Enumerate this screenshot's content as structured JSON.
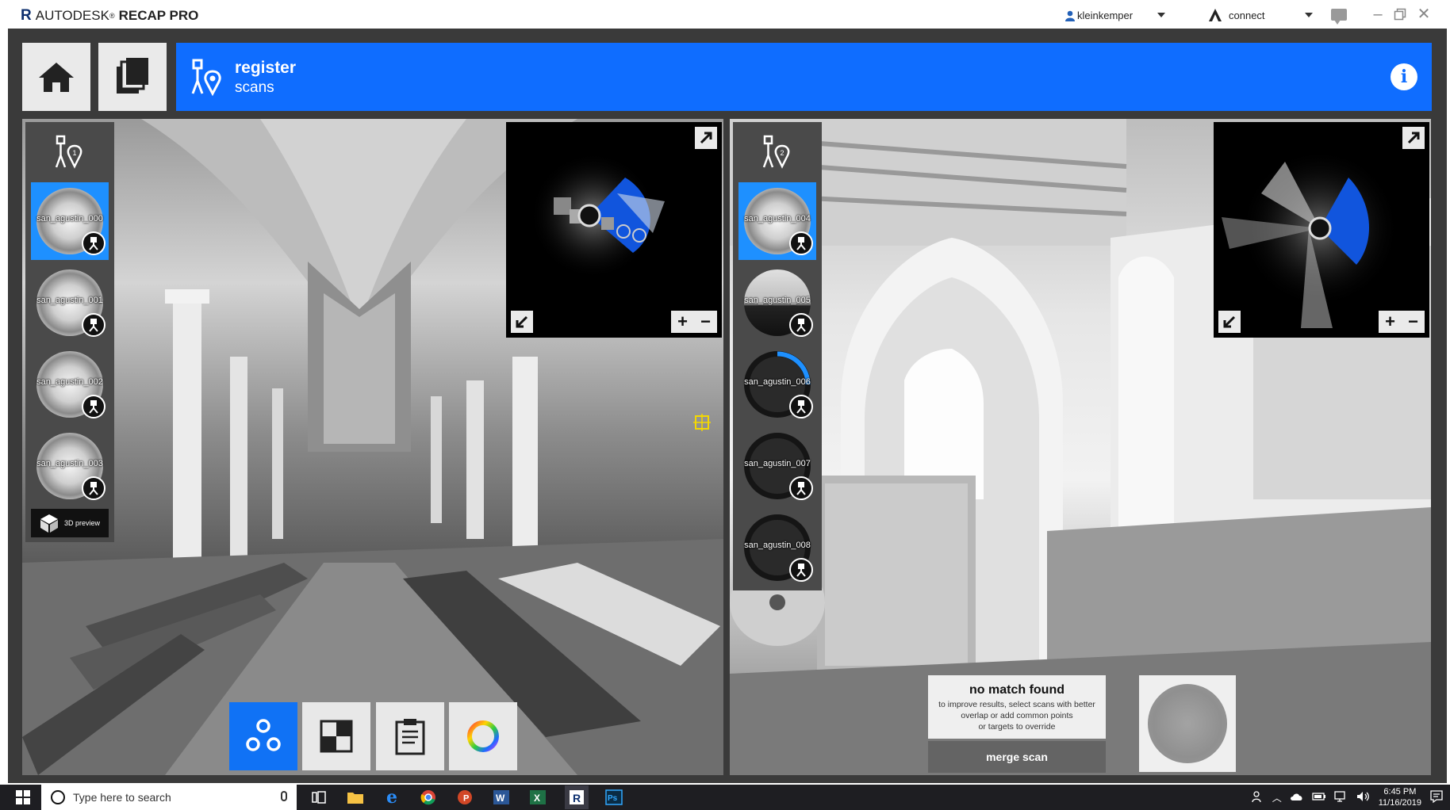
{
  "app": {
    "logo_letter": "R",
    "brand": "AUTODESK",
    "product": "RECAP PRO",
    "user": "kleinkemper",
    "connect": "connect",
    "window_controls": [
      "minimize",
      "restore",
      "close"
    ]
  },
  "header": {
    "title": "register",
    "subtitle": "scans",
    "home_icon": "home-icon",
    "pages_icon": "pages-icon",
    "info": "i"
  },
  "left_view": {
    "scans": [
      {
        "label": "san_agustin_000",
        "selected": true
      },
      {
        "label": "san_agustin_001",
        "selected": false
      },
      {
        "label": "san_agustin_002",
        "selected": false
      },
      {
        "label": "san_agustin_003",
        "selected": false
      }
    ],
    "preview_label": "3D preview"
  },
  "right_view": {
    "scans": [
      {
        "label": "san_agustin_004",
        "selected": true
      },
      {
        "label": "san_agustin_005",
        "selected": false
      },
      {
        "label": "san_agustin_006",
        "selected": false,
        "progress": 0.25
      },
      {
        "label": "san_agustin_007",
        "selected": false
      },
      {
        "label": "san_agustin_008",
        "selected": false
      }
    ]
  },
  "result": {
    "title": "no match found",
    "message_line1": "to improve results, select scans with better",
    "message_line2": "overlap or add common points",
    "message_line3": "or targets to override",
    "merge_button": "merge scan"
  },
  "toolbar": {
    "tools": [
      "cloud-to-cloud",
      "checkerboard",
      "report",
      "color-wheel"
    ],
    "active": "cloud-to-cloud"
  },
  "taskbar": {
    "search_placeholder": "Type here to search",
    "time": "6:45 PM",
    "date": "11/16/2019"
  },
  "colors": {
    "accent": "#0f6dff",
    "selected": "#1e90ff",
    "panel": "#eaeaea"
  }
}
